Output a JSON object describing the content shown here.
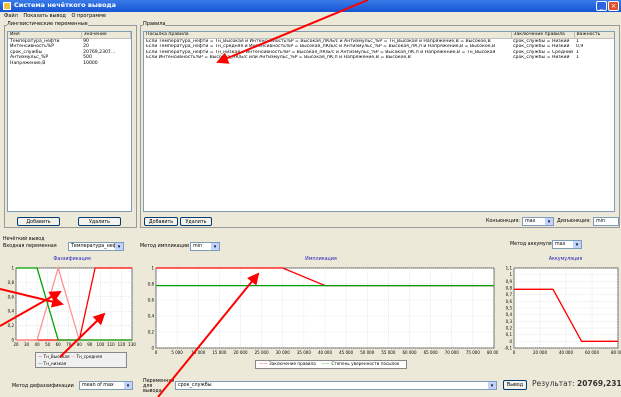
{
  "window": {
    "title": "Система нечёткого вывода"
  },
  "menu": [
    "Файл",
    "Показать вывод",
    "О программе"
  ],
  "ling_vars": {
    "group_label": "Лингвистические переменные",
    "columns": [
      "Имя",
      "Значение"
    ],
    "rows": [
      [
        "Температура_нефти",
        "90"
      ],
      [
        "Интенсивность%P",
        "20"
      ],
      [
        "срок_службы",
        "20769,2307..."
      ],
      [
        "Антиэмульс_%P",
        "500"
      ],
      [
        "Напряжение,В",
        "10000"
      ]
    ],
    "add_label": "Добавить",
    "delete_label": "Удалить"
  },
  "rules": {
    "group_label": "Правила",
    "columns": [
      "Посылка правила",
      "Заключение правила",
      "Важность"
    ],
    "rows": [
      [
        "Если Температура_нефти = Тн_Высокая и Интенсивность%P = Высокая_пК/Б/с и Антиэмульс_%P = Тн_Высокая и Напряжение,В = Высокое,В",
        "срок_службы = Низкий",
        "1"
      ],
      [
        "Если Температура_нефти = Тн_средняя и Интенсивность%P = Высокая_пК/Б/с и Антиэмульс_%P = Высокая_пК,п и Напряжение,В = Высокое,В",
        "срок_службы = Низкий",
        "0,9"
      ],
      [
        "Если Температура_нефти = Тн_низкая и Интенсивность%P = Высокая_пК/Б/с и Антиэмульс_%P = Высокая_пК,п и Напряжение,В = Тн_Высокая",
        "срок_службы = Средний",
        "1"
      ],
      [
        "Если Интенсивность%P = Высокая_пК/Б/с или Антиэмульс_%P = Высокая_пК,п и Напряжение,В = Высокое,В",
        "срок_службы = Низкий",
        "1"
      ]
    ],
    "add_label": "Добавить",
    "delete_label": "Удалить",
    "conjunction_label": "Конъюнкция:",
    "conjunction_value": "max",
    "disjunction_label": "Дизъюнкция:",
    "disjunction_value": "min"
  },
  "inference": {
    "group_label": "Нечёткий вывод",
    "input_var_label": "Входная переменная",
    "input_var_value": "Температура_нефти",
    "implication_method_label": "Метод импликации",
    "implication_method_value": "min",
    "accumulation_method_label": "Метод аккумуляции",
    "accumulation_method_value": "max",
    "defuzz_label": "Метод дефаззификации",
    "defuzz_value": "mean of max",
    "output_var_label": "Переменная для вывода",
    "output_var_value": "срок_службы",
    "run_label": "Вывод",
    "result_label": "Результат:",
    "result_value": "20769,231"
  },
  "charts": {
    "fuzz_title": "Фаззификация",
    "impl_title": "Импликация",
    "accum_title": "Аккумуляция",
    "fuzz_legend": [
      "Тн_Высокая",
      "Тн_средняя",
      "Тн_низкая"
    ],
    "impl_legend": [
      "Заключение правила",
      "Степень уверенности посылок"
    ],
    "colors": {
      "red": "#ff0000",
      "green": "#00a000",
      "pink": "#ff9090",
      "lightgreen": "#90e090"
    }
  },
  "chart_data": [
    {
      "type": "line",
      "title": "Фаззификация",
      "xlim": [
        20,
        130
      ],
      "ylim": [
        0,
        1
      ],
      "x_ticks": [
        20,
        30,
        40,
        50,
        60,
        70,
        80,
        90,
        100,
        110,
        120,
        130
      ],
      "y_ticks": [
        0,
        0.2,
        0.4,
        0.6,
        0.8,
        1
      ],
      "series": [
        {
          "name": "Тн_Высокая",
          "color": "#ff0000",
          "x": [
            20,
            80,
            95,
            130
          ],
          "y": [
            0,
            0,
            1,
            1
          ]
        },
        {
          "name": "Тн_средняя",
          "color": "#ff9090",
          "x": [
            20,
            40,
            60,
            80,
            130
          ],
          "y": [
            0,
            0,
            1,
            0,
            0
          ]
        },
        {
          "name": "Тн_низкая",
          "color": "#00a000",
          "x": [
            20,
            40,
            60,
            130
          ],
          "y": [
            1,
            1,
            0,
            0
          ]
        }
      ]
    },
    {
      "type": "line",
      "title": "Импликация",
      "xlim": [
        0,
        80000
      ],
      "ylim": [
        0,
        1
      ],
      "x_ticks": [
        0,
        5000,
        10000,
        15000,
        20000,
        25000,
        30000,
        35000,
        40000,
        45000,
        50000,
        55000,
        60000,
        65000,
        70000,
        75000,
        80000
      ],
      "y_ticks": [
        0,
        0.2,
        0.4,
        0.6,
        0.8,
        1
      ],
      "series": [
        {
          "name": "Заключение правила",
          "color": "#ff0000",
          "x": [
            0,
            30000,
            40000,
            80000
          ],
          "y": [
            1,
            1,
            0.78,
            0.78
          ]
        },
        {
          "name": "Степень уверенности посылок",
          "color": "#00a000",
          "x": [
            0,
            80000
          ],
          "y": [
            0.78,
            0.78
          ]
        }
      ]
    },
    {
      "type": "line",
      "title": "Аккумуляция",
      "xlim": [
        0,
        80000
      ],
      "ylim": [
        -0.1,
        1.1
      ],
      "x_ticks": [
        0,
        20000,
        40000,
        60000,
        80000
      ],
      "y_ticks": [
        -0.1,
        0,
        0.1,
        0.2,
        0.3,
        0.4,
        0.5,
        0.6,
        0.7,
        0.8,
        0.9,
        1,
        1.1
      ],
      "series": [
        {
          "name": "",
          "color": "#ff0000",
          "x": [
            0,
            30000,
            52000,
            80000
          ],
          "y": [
            0.78,
            0.78,
            0,
            0
          ]
        }
      ]
    }
  ]
}
